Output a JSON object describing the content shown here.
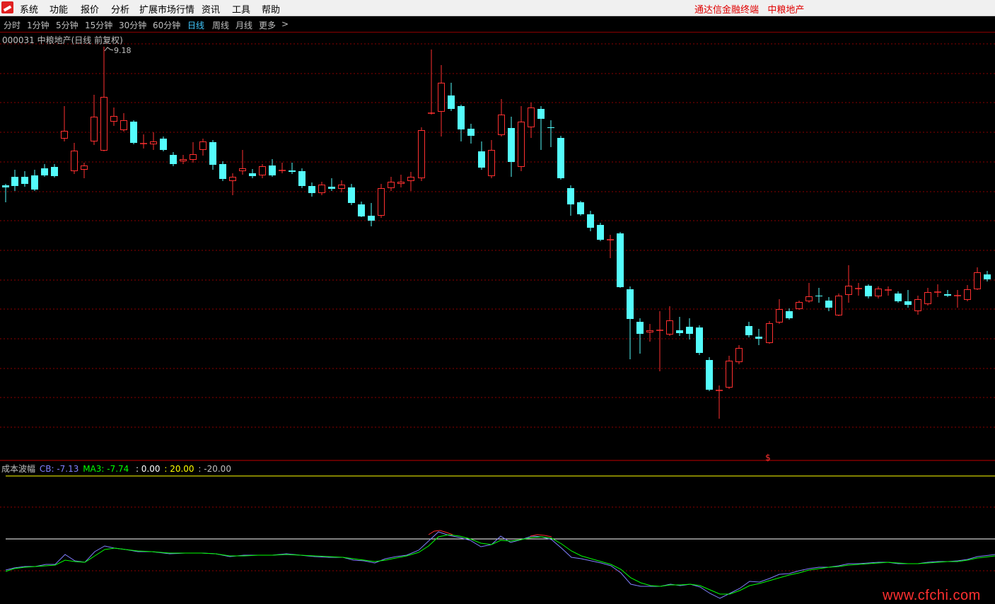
{
  "app": {
    "menu": [
      "系统",
      "功能",
      "报价",
      "分析",
      "扩展市场行情",
      "资讯",
      "工具",
      "帮助"
    ],
    "title": "通达信金融终端",
    "stock_name_title": "中粮地产",
    "logo_icon": "tdx-logo-icon"
  },
  "periods": {
    "items": [
      "分时",
      "1分钟",
      "5分钟",
      "15分钟",
      "30分钟",
      "60分钟",
      "日线",
      "周线",
      "月线",
      "更多"
    ],
    "active": "日线",
    "more_icon": "chevron-right-icon",
    "more_glyph": ">"
  },
  "chart": {
    "title": "000031 中粮地产(日线 前复权)",
    "high_label": "9.18",
    "marker": "$",
    "colors": {
      "up": "#ff3030",
      "down": "#54fcfc",
      "grid": "#8b0000"
    }
  },
  "indicator": {
    "name": "成本波幅",
    "cb_label": "CB: -7.13",
    "ma_label": "MA3: -7.74",
    "lvl0": ": 0.00",
    "lvl1": ": 20.00",
    "lvl2": ": -20.00",
    "colors": {
      "cb": "#8080ff",
      "ma": "#00ff00",
      "lvl20": "#ffff00",
      "lvl0": "#ffffff"
    }
  },
  "watermark": "www.cfchi.com"
}
